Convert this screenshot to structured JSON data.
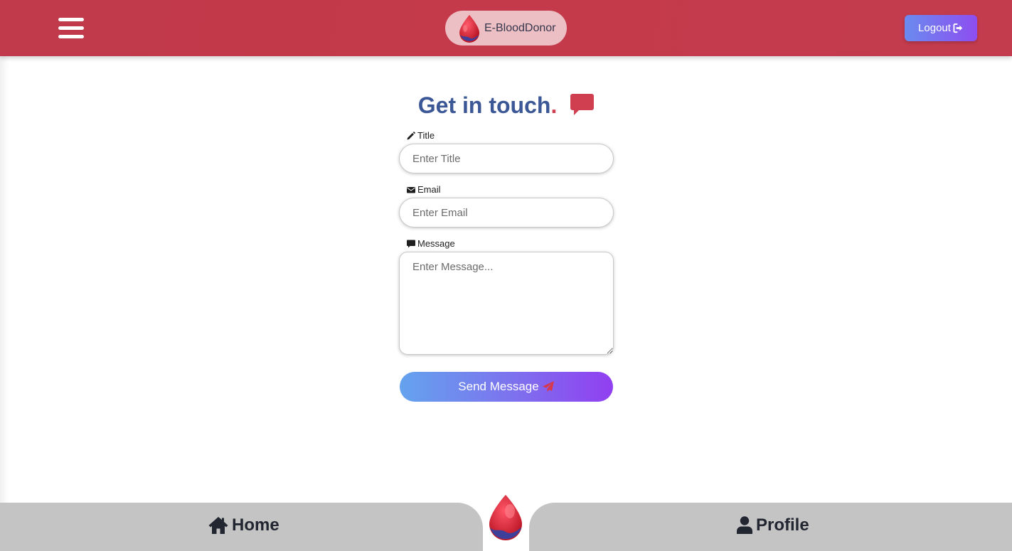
{
  "header": {
    "brand_name": "E-BloodDonor",
    "logout_label": "Logout",
    "menu_icon": "hamburger-menu-icon",
    "colors": {
      "bar": "#c43a4a",
      "button_start": "#6a8bef",
      "button_end": "#8e4df0"
    }
  },
  "contact": {
    "heading": "Get in touch",
    "heading_dot": ".",
    "fields": {
      "title": {
        "label": "Title",
        "placeholder": "Enter Title",
        "value": "",
        "icon": "pencil-icon"
      },
      "email": {
        "label": "Email",
        "placeholder": "Enter Email",
        "value": "",
        "icon": "envelope-icon"
      },
      "message": {
        "label": "Message",
        "placeholder": "Enter Message...",
        "value": "",
        "icon": "comment-icon"
      }
    },
    "send_label": "Send Message",
    "colors": {
      "heading": "#3b5796",
      "accent": "#cf3f4f"
    }
  },
  "bottom_nav": {
    "home_label": "Home",
    "profile_label": "Profile",
    "colors": {
      "bar": "#c4c4c4",
      "text": "#212631"
    }
  }
}
